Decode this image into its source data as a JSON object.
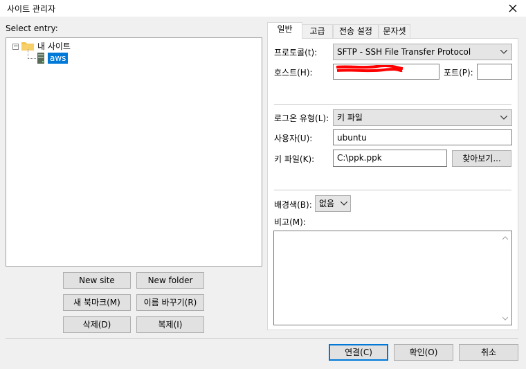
{
  "window": {
    "title": "사이트 관리자"
  },
  "left": {
    "select_entry_label": "Select entry:",
    "tree": {
      "root": "내 사이트",
      "child": "aws"
    },
    "buttons": {
      "new_site": "New site",
      "new_folder": "New folder",
      "new_bookmark": "새 북마크(M)",
      "rename": "이름 바꾸기(R)",
      "delete": "삭제(D)",
      "copy": "복제(I)"
    }
  },
  "tabs": [
    "일반",
    "고급",
    "전송 설정",
    "문자셋"
  ],
  "general": {
    "protocol_label": "프로토콜(t):",
    "protocol_value": "SFTP - SSH File Transfer Protocol",
    "host_label": "호스트(H):",
    "port_label": "포트(P):",
    "port_value": "",
    "logon_type_label": "로그온 유형(L):",
    "logon_type_value": "키 파일",
    "user_label": "사용자(U):",
    "user_value": "ubuntu",
    "keyfile_label": "키 파일(K):",
    "keyfile_value": "C:\\ppk.ppk",
    "browse_button": "찾아보기...",
    "bgcolor_label": "배경색(B):",
    "bgcolor_value": "없음",
    "comments_label": "비고(M):"
  },
  "footer": {
    "connect": "연결(C)",
    "ok": "확인(O)",
    "cancel": "취소"
  },
  "colors": {
    "selection": "#0078d7",
    "redaction": "#ff0000"
  }
}
